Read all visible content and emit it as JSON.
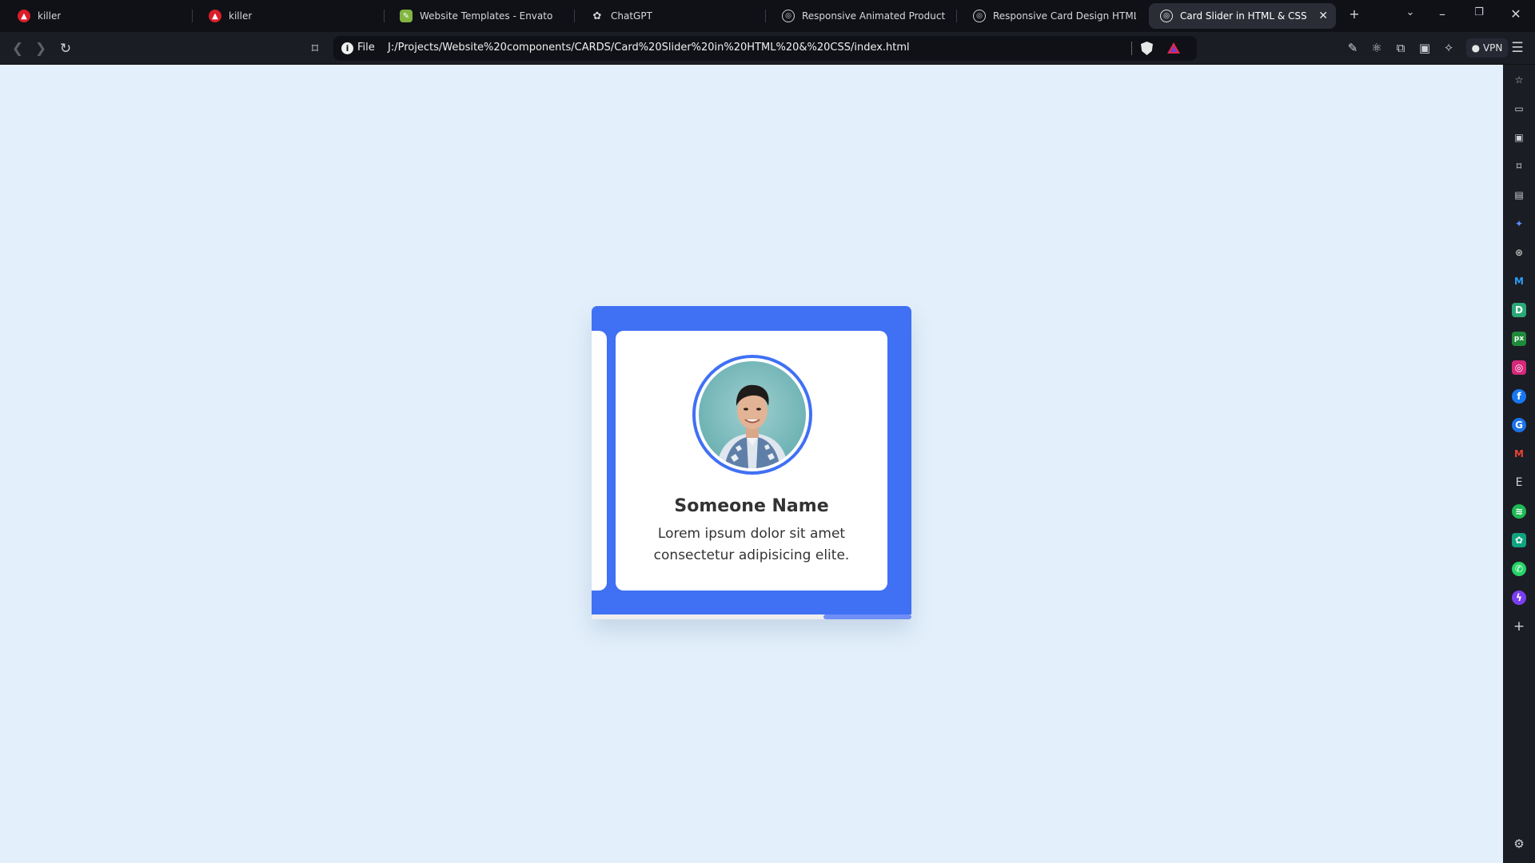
{
  "tabs": [
    {
      "label": "killer",
      "icon": "brave-red-icon"
    },
    {
      "label": "killer",
      "icon": "brave-red-icon"
    },
    {
      "label": "Website Templates - Envato",
      "icon": "envato-icon"
    },
    {
      "label": "ChatGPT",
      "icon": "chatgpt-icon"
    },
    {
      "label": "Responsive Animated Product Card",
      "icon": "globe-icon"
    },
    {
      "label": "Responsive Card Design HTML and",
      "icon": "globe-icon"
    },
    {
      "label": "Card Slider in HTML & CSS",
      "icon": "globe-icon",
      "active": true
    }
  ],
  "toolbar": {
    "scheme": "File",
    "url": "J:/Projects/Website%20components/CARDS/Card%20Slider%20in%20HTML%20&%20CSS/index.html",
    "vpn_label": "VPN"
  },
  "card": {
    "title": "Someone Name",
    "description": "Lorem ipsum dolor sit amet consectetur adipisicing elite."
  },
  "colors": {
    "accent": "#4070f4",
    "page_bg": "#e3f0fb"
  },
  "sidebar_icons": [
    "star-icon",
    "video-icon",
    "wallet-icon",
    "bookmark-icon",
    "reader-icon",
    "leo-ai-icon",
    "brave-icon",
    "malwarebytes-icon",
    "dribbble-icon",
    "pixel-icon",
    "instagram-icon",
    "facebook-icon",
    "google-icon",
    "gmail-icon",
    "envato-e-icon",
    "spotify-icon",
    "chatgpt-icon",
    "whatsapp-icon",
    "messenger-icon",
    "add-icon",
    "settings-icon"
  ]
}
